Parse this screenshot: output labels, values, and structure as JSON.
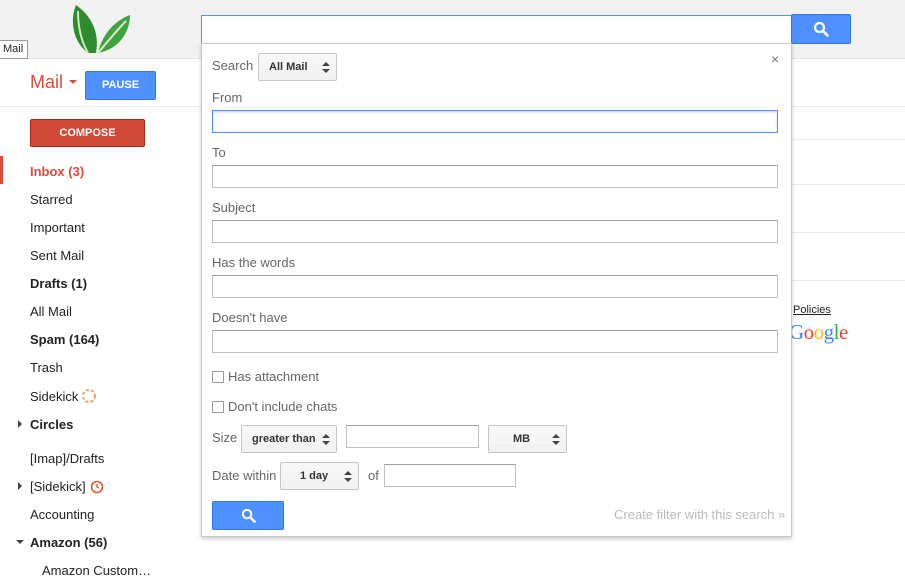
{
  "tooltip": "Mail",
  "header": {
    "mail_label": "Mail",
    "pause_label": "PAUSE"
  },
  "compose_label": "COMPOSE",
  "sidebar": {
    "items": [
      {
        "label": "Inbox (3)"
      },
      {
        "label": "Starred"
      },
      {
        "label": "Important"
      },
      {
        "label": "Sent Mail"
      },
      {
        "label": "Drafts (1)"
      },
      {
        "label": "All Mail"
      },
      {
        "label": "Spam (164)"
      },
      {
        "label": "Trash"
      },
      {
        "label": "Sidekick"
      },
      {
        "label": "Circles"
      },
      {
        "label": "[Imap]/Drafts"
      },
      {
        "label": "[Sidekick]"
      },
      {
        "label": "Accounting"
      },
      {
        "label": "Amazon (56)"
      },
      {
        "label": "Amazon Custom…"
      }
    ]
  },
  "right": {
    "policies": "Policies",
    "google": [
      "G",
      "o",
      "o",
      "g",
      "l",
      "e"
    ]
  },
  "search_panel": {
    "search_label": "Search",
    "scope": "All Mail",
    "from_label": "From",
    "to_label": "To",
    "subject_label": "Subject",
    "has_words_label": "Has the words",
    "doesnt_have_label": "Doesn't have",
    "has_attachment_label": "Has attachment",
    "no_chats_label": "Don't include chats",
    "size_label": "Size",
    "size_op": "greater than",
    "size_unit": "MB",
    "date_within_label": "Date within",
    "date_within": "1 day",
    "of_label": "of",
    "create_filter": "Create filter with this search »",
    "close": "×"
  },
  "colors": {
    "accent_blue": "#4d90fe",
    "gmail_red": "#dd4b39",
    "compose_red": "#d14836"
  }
}
